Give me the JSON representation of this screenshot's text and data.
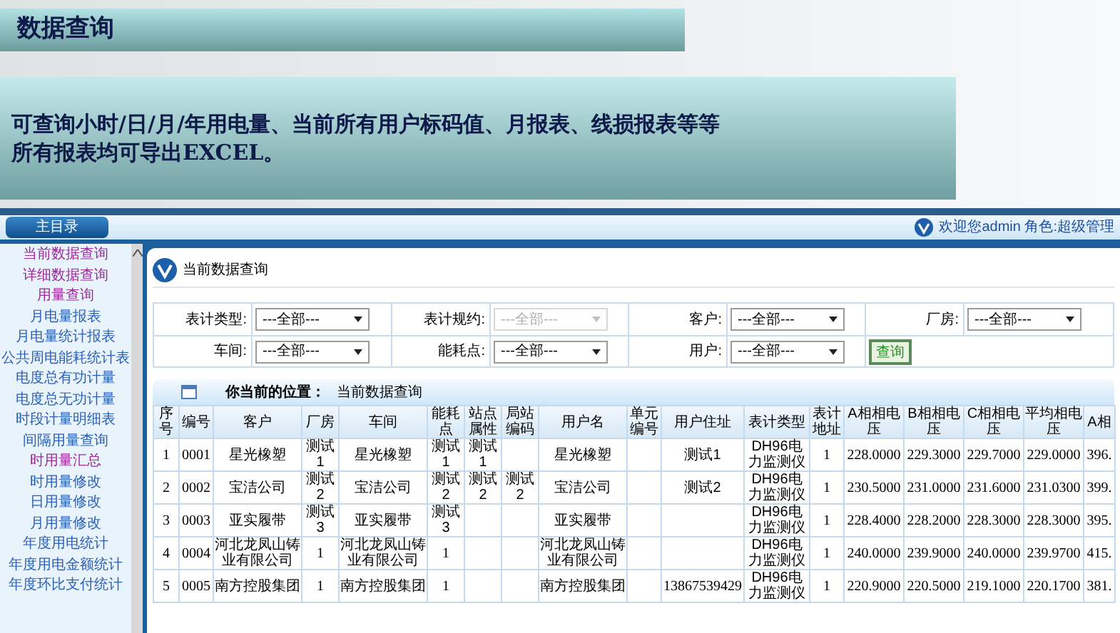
{
  "slide": {
    "title": "数据查询",
    "lines": [
      "可查询小时/日/月/年用电量、当前所有用户标码值、月报表、线损报表等等",
      "所有报表均可导出EXCEL。"
    ]
  },
  "header": {
    "menu_tab": "主目录",
    "welcome": "欢迎您admin 角色:超级管理"
  },
  "sidebar": {
    "items": [
      {
        "label": "当前数据查询",
        "visited": true
      },
      {
        "label": "详细数据查询",
        "visited": true
      },
      {
        "label": "用量查询",
        "visited": true
      },
      {
        "label": "月电量报表",
        "visited": false
      },
      {
        "label": "月电量统计报表",
        "visited": false
      },
      {
        "label": "公共周电能耗统计表",
        "visited": false
      },
      {
        "label": "电度总有功计量",
        "visited": false
      },
      {
        "label": "电度总无功计量",
        "visited": false
      },
      {
        "label": "时段计量明细表",
        "visited": false
      },
      {
        "label": "间隔用量查询",
        "visited": false
      },
      {
        "label": "时用量汇总",
        "visited": true
      },
      {
        "label": "时用量修改",
        "visited": false
      },
      {
        "label": "日用量修改",
        "visited": false
      },
      {
        "label": "月用量修改",
        "visited": false
      },
      {
        "label": "年度用电统计",
        "visited": false
      },
      {
        "label": "年度用电金额统计",
        "visited": false
      },
      {
        "label": "年度环比支付统计",
        "visited": false
      }
    ]
  },
  "panel": {
    "title": "当前数据查询",
    "filters": [
      [
        {
          "label": "表计类型:",
          "value": "---全部---",
          "disabled": false
        },
        {
          "label": "表计规约:",
          "value": "---全部---",
          "disabled": true
        },
        {
          "label": "客户:",
          "value": "---全部---",
          "disabled": false
        },
        {
          "label": "厂房:",
          "value": "---全部---",
          "disabled": false
        }
      ],
      [
        {
          "label": "车间:",
          "value": "---全部---",
          "disabled": false
        },
        {
          "label": "能耗点:",
          "value": "---全部---",
          "disabled": false
        },
        {
          "label": "用户:",
          "value": "---全部---",
          "disabled": false
        }
      ]
    ],
    "query_button": "查询",
    "location_label": "你当前的位置：",
    "location_value": "当前数据查询",
    "table": {
      "columns": [
        "序号",
        "编号",
        "客户",
        "厂房",
        "车间",
        "能耗点",
        "站点属性",
        "局站编码",
        "用户名",
        "单元编号",
        "用户住址",
        "表计类型",
        "表计地址",
        "A相相电压",
        "B相相电压",
        "C相相电压",
        "平均相电压",
        "A相"
      ],
      "rows": [
        [
          "1",
          "0001",
          "星光橡塑",
          "测试1",
          "星光橡塑",
          "测试1",
          "测试1",
          "",
          "星光橡塑",
          "",
          "测试1",
          "DH96电力监测仪",
          "1",
          "228.0000",
          "229.3000",
          "229.7000",
          "229.0000",
          "396."
        ],
        [
          "2",
          "0002",
          "宝洁公司",
          "测试2",
          "宝洁公司",
          "测试2",
          "测试2",
          "测试2",
          "宝洁公司",
          "",
          "测试2",
          "DH96电力监测仪",
          "1",
          "230.5000",
          "231.0000",
          "231.6000",
          "231.0300",
          "399."
        ],
        [
          "3",
          "0003",
          "亚实履带",
          "测试3",
          "亚实履带",
          "测试3",
          "",
          "",
          "亚实履带",
          "",
          "",
          "DH96电力监测仪",
          "1",
          "228.4000",
          "228.2000",
          "228.3000",
          "228.3000",
          "395."
        ],
        [
          "4",
          "0004",
          "河北龙凤山铸业有限公司",
          "1",
          "河北龙凤山铸业有限公司",
          "1",
          "",
          "",
          "河北龙凤山铸业有限公司",
          "",
          "",
          "DH96电力监测仪",
          "1",
          "240.0000",
          "239.9000",
          "240.0000",
          "239.9700",
          "415."
        ],
        [
          "5",
          "0005",
          "南方控股集团",
          "1",
          "南方控股集团",
          "1",
          "",
          "",
          "南方控股集团",
          "",
          "13867539429",
          "DH96电力监测仪",
          "1",
          "220.9000",
          "220.5000",
          "219.1000",
          "220.1700",
          "381."
        ]
      ]
    }
  }
}
